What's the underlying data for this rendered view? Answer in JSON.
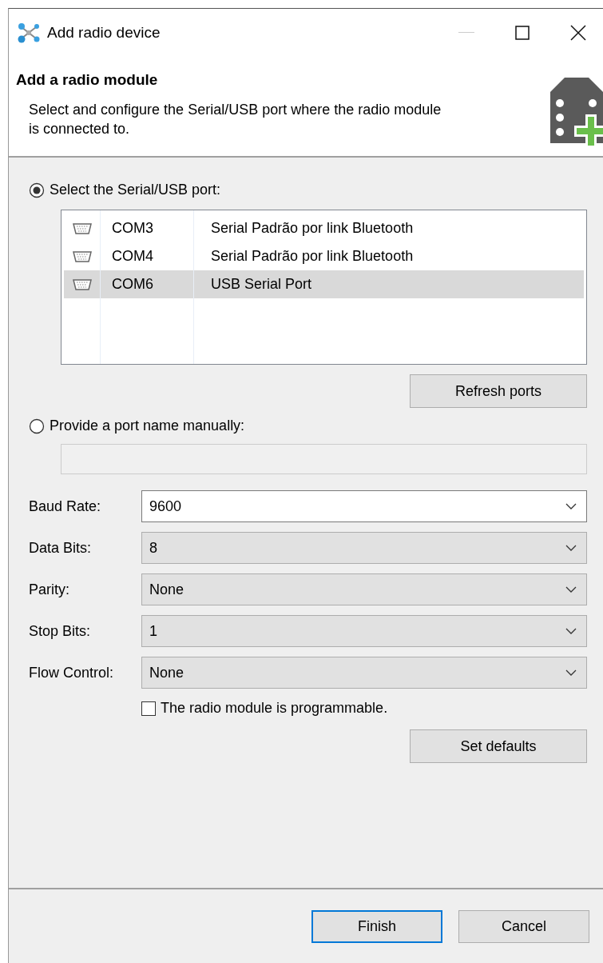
{
  "window": {
    "title": "Add radio device"
  },
  "header": {
    "title": "Add a radio module",
    "description": "Select and configure the Serial/USB port where the radio module is connected to."
  },
  "port_modes": [
    {
      "label": "Select the Serial/USB port:",
      "selected": true
    },
    {
      "label": "Provide a port name manually:",
      "selected": false
    }
  ],
  "ports": [
    {
      "name": "COM3",
      "description": "Serial Padrão por link Bluetooth",
      "selected": false
    },
    {
      "name": "COM4",
      "description": "Serial Padrão por link Bluetooth",
      "selected": false
    },
    {
      "name": "COM6",
      "description": "USB Serial Port",
      "selected": true
    }
  ],
  "refresh_button": "Refresh ports",
  "manual_port": {
    "disabled": true
  },
  "settings": [
    {
      "label": "Baud Rate:",
      "value": "9600",
      "disabled": false
    },
    {
      "label": "Data Bits:",
      "value": "8",
      "disabled": true
    },
    {
      "label": "Parity:",
      "value": "None",
      "disabled": true
    },
    {
      "label": "Stop Bits:",
      "value": "1",
      "disabled": true
    },
    {
      "label": "Flow Control:",
      "value": "None",
      "disabled": true
    }
  ],
  "programmable": {
    "label": "The radio module is programmable.",
    "checked": false
  },
  "defaults_button": "Set defaults",
  "buttons": [
    {
      "label": "Finish",
      "kind": "default"
    },
    {
      "label": "Cancel",
      "kind": "normal"
    }
  ]
}
